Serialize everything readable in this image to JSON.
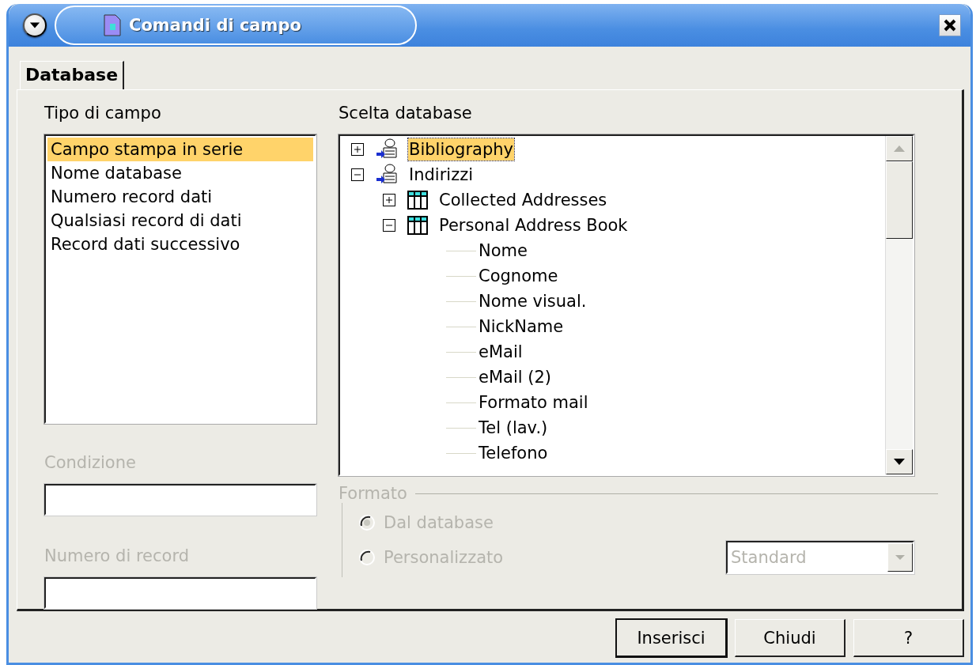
{
  "window": {
    "title": "Comandi di campo"
  },
  "tabs": [
    {
      "label": "Database",
      "selected": true
    }
  ],
  "field_type": {
    "label": "Tipo di campo",
    "items": [
      {
        "label": "Campo stampa in serie",
        "selected": true
      },
      {
        "label": "Nome database",
        "selected": false
      },
      {
        "label": "Numero record dati",
        "selected": false
      },
      {
        "label": "Qualsiasi record di dati",
        "selected": false
      },
      {
        "label": "Record dati successivo",
        "selected": false
      }
    ]
  },
  "condition": {
    "label": "Condizione",
    "disabled": true
  },
  "record_number": {
    "label": "Numero di record",
    "disabled": true
  },
  "database_selection": {
    "label": "Scelta database",
    "tree": [
      {
        "label": "Bibliography",
        "kind": "database",
        "expanded": false,
        "selected": true
      },
      {
        "label": "Indirizzi",
        "kind": "database",
        "expanded": true,
        "selected": false,
        "children": [
          {
            "label": "Collected Addresses",
            "kind": "table",
            "expanded": false,
            "selected": false
          },
          {
            "label": "Personal Address Book",
            "kind": "table",
            "expanded": true,
            "selected": false,
            "children": [
              {
                "label": "Nome",
                "kind": "field",
                "selected": false
              },
              {
                "label": "Cognome",
                "kind": "field",
                "selected": false
              },
              {
                "label": "Nome visual.",
                "kind": "field",
                "selected": false
              },
              {
                "label": "NickName",
                "kind": "field",
                "selected": false
              },
              {
                "label": "eMail",
                "kind": "field",
                "selected": false
              },
              {
                "label": "eMail (2)",
                "kind": "field",
                "selected": false
              },
              {
                "label": "Formato mail",
                "kind": "field",
                "selected": false
              },
              {
                "label": "Tel (lav.)",
                "kind": "field",
                "selected": false
              },
              {
                "label": "Telefono",
                "kind": "field",
                "selected": false
              }
            ]
          }
        ]
      }
    ]
  },
  "format": {
    "label": "Formato",
    "disabled": true,
    "options": [
      {
        "label": "Dal database",
        "selected": true
      },
      {
        "label": "Personalizzato",
        "selected": false
      }
    ],
    "dropdown": {
      "value": "Standard"
    }
  },
  "buttons": [
    {
      "label": "Inserisci",
      "default": true
    },
    {
      "label": "Chiudi",
      "default": false
    },
    {
      "label": "?",
      "default": false
    }
  ]
}
